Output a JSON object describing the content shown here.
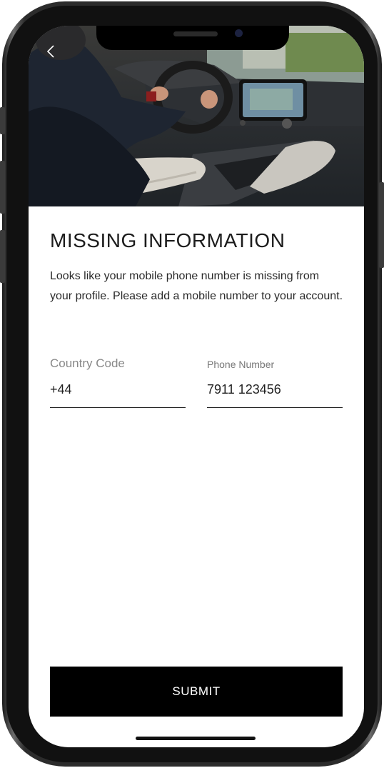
{
  "screen": {
    "title": "MISSING INFORMATION",
    "description": "Looks like your mobile phone number is missing from your profile. Please add a mobile number to your account.",
    "back_icon": "chevron-left-icon"
  },
  "form": {
    "country_code": {
      "label": "Country Code",
      "value": "+44"
    },
    "phone_number": {
      "label": "Phone Number",
      "value": "7911 123456"
    }
  },
  "actions": {
    "submit_label": "SUBMIT"
  }
}
